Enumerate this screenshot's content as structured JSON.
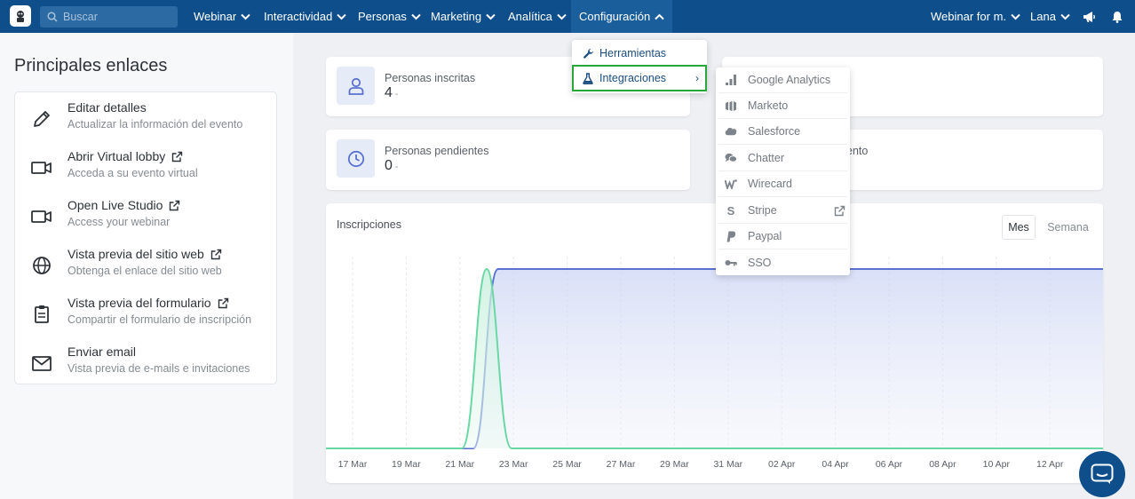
{
  "navbar": {
    "search_placeholder": "Buscar",
    "items": [
      "Webinar",
      "Interactividad",
      "Personas",
      "Marketing",
      "Analítica",
      "Configuración"
    ],
    "right": {
      "event": "Webinar for m.",
      "user": "Lana"
    }
  },
  "sidebar": {
    "title": "Principales enlaces",
    "links": [
      {
        "title": "Editar detalles",
        "subtitle": "Actualizar la información del evento",
        "icon": "pencil-icon",
        "external": false
      },
      {
        "title": "Abrir Virtual lobby",
        "subtitle": "Acceda a su evento virtual",
        "icon": "video-camera-icon",
        "external": true
      },
      {
        "title": "Open Live Studio",
        "subtitle": "Access your webinar",
        "icon": "video-camera-icon",
        "external": true
      },
      {
        "title": "Vista previa del sitio web",
        "subtitle": "Obtenga el enlace del sitio web",
        "icon": "globe-icon",
        "external": true
      },
      {
        "title": "Vista previa del formulario",
        "subtitle": "Compartir el formulario de inscripción",
        "icon": "clipboard-icon",
        "external": true
      },
      {
        "title": "Enviar email",
        "subtitle": "Vista previa de e-mails e invitaciones",
        "icon": "envelope-icon",
        "external": false
      }
    ]
  },
  "stats": {
    "registered": {
      "label": "Personas inscritas",
      "value": "4",
      "delta": "-"
    },
    "pending": {
      "label": "Personas pendientes",
      "value": "0",
      "delta": "-"
    },
    "partial_label_right": "ento"
  },
  "config_menu": {
    "items": [
      {
        "label": "Herramientas",
        "icon": "wrench-icon"
      },
      {
        "label": "Integraciones",
        "icon": "flask-icon"
      }
    ]
  },
  "integrations_menu": {
    "items": [
      {
        "label": "Google Analytics",
        "icon": "bar-chart-icon"
      },
      {
        "label": "Marketo",
        "icon": "marketo-icon"
      },
      {
        "label": "Salesforce",
        "icon": "cloud-icon"
      },
      {
        "label": "Chatter",
        "icon": "chat-bubbles-icon"
      },
      {
        "label": "Wirecard",
        "icon": "wirecard-icon"
      },
      {
        "label": "Stripe",
        "icon": "stripe-icon"
      },
      {
        "label": "Paypal",
        "icon": "paypal-icon"
      },
      {
        "label": "SSO",
        "icon": "key-icon"
      }
    ]
  },
  "chart": {
    "toggle": {
      "month": "Mes",
      "week": "Semana"
    }
  },
  "chart_data": {
    "type": "area",
    "title": "Inscripciones",
    "categories": [
      "17 Mar",
      "19 Mar",
      "21 Mar",
      "23 Mar",
      "25 Mar",
      "27 Mar",
      "29 Mar",
      "31 Mar",
      "02 Apr",
      "04 Apr",
      "06 Apr",
      "08 Apr",
      "10 Apr",
      "12 Apr"
    ],
    "series": [
      {
        "values": [
          0,
          0,
          0,
          4,
          4,
          4,
          4,
          4,
          4,
          4,
          4,
          4,
          4,
          4
        ],
        "color": "#5b72d1"
      },
      {
        "values": [
          0,
          0,
          0,
          0,
          0,
          0,
          0,
          0,
          0,
          0,
          0,
          0,
          0,
          0
        ],
        "peak": {
          "near": "22 Mar",
          "value": 4
        },
        "color": "#6ad8a4"
      }
    ],
    "grid": true
  },
  "colors": {
    "navbar": "#0e4f8b",
    "accent": "#1a4d80",
    "selected_outline": "#2aa63a"
  }
}
